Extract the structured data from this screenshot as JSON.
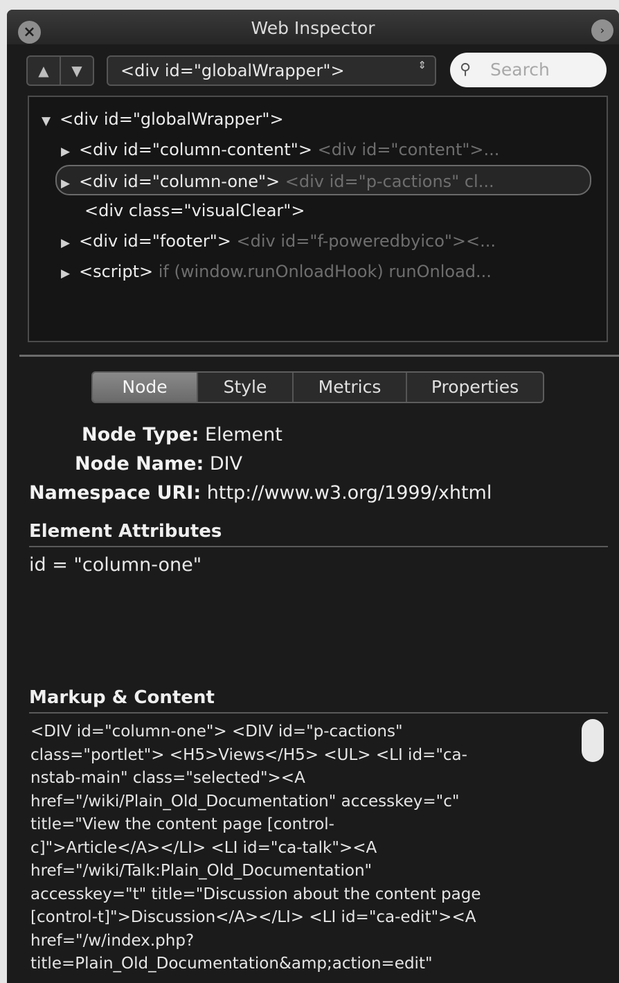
{
  "window": {
    "title": "Web Inspector",
    "close_glyph": "×",
    "collapse_glyph": "›"
  },
  "toolbar": {
    "back_glyph": "▲",
    "forward_glyph": "▼",
    "selected_node": "<div id=\"globalWrapper\">",
    "select_arrows": "⇕",
    "search_placeholder": "Search",
    "search_icon_glyph": "⚲"
  },
  "tree": {
    "rows": [
      {
        "tri": "▼",
        "tag": "<div id=\"globalWrapper\">",
        "preview": ""
      },
      {
        "tri": "▶",
        "tag": "<div id=\"column-content\">",
        "preview": "<div id=\"content\">..."
      },
      {
        "tri": "▶",
        "tag": "<div id=\"column-one\">",
        "preview": "<div id=\"p-cactions\" cl..."
      },
      {
        "tri": "",
        "tag": "<div class=\"visualClear\">",
        "preview": ""
      },
      {
        "tri": "▶",
        "tag": "<div id=\"footer\">",
        "preview": "<div id=\"f-poweredbyico\"><..."
      },
      {
        "tri": "▶",
        "tag": "<script>",
        "preview": "if (window.runOnloadHook) runOnload..."
      }
    ]
  },
  "tabs": [
    {
      "label": "Node"
    },
    {
      "label": "Style"
    },
    {
      "label": "Metrics"
    },
    {
      "label": "Properties"
    }
  ],
  "node": {
    "type_label": "Node Type:",
    "type_value": "Element",
    "name_label": "Node Name:",
    "name_value": "DIV",
    "ns_label": "Namespace URI:",
    "ns_value": "http://www.w3.org/1999/xhtml"
  },
  "attributes": {
    "heading": "Element Attributes",
    "items": [
      "id = \"column-one\""
    ]
  },
  "markup": {
    "heading": "Markup & Content",
    "lines": [
      "<DIV id=\"column-one\"> <DIV id=\"p-cactions\"",
      "class=\"portlet\"> <H5>Views</H5> <UL> <LI id=\"ca-",
      "nstab-main\" class=\"selected\"><A",
      "href=\"/wiki/Plain_Old_Documentation\" accesskey=\"c\"",
      "title=\"View the content page [control-",
      "c]\">Article</A></LI> <LI id=\"ca-talk\"><A",
      "href=\"/wiki/Talk:Plain_Old_Documentation\"",
      "accesskey=\"t\" title=\"Discussion about the content page",
      "[control-t]\">Discussion</A></LI> <LI id=\"ca-edit\"><A",
      "href=\"/w/index.php?",
      "title=Plain_Old_Documentation&amp;action=edit\""
    ]
  }
}
